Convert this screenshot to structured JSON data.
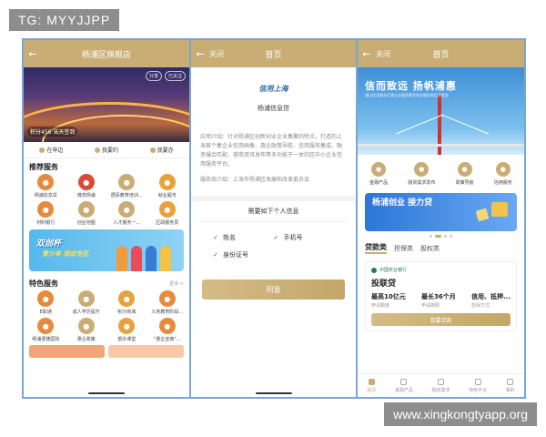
{
  "overlay": {
    "tag": "TG: MYYJJPP",
    "watermark": "www.xingkongtyapp.org"
  },
  "colors": {
    "gold": "#c9ad74",
    "frame": "#7aa6d4"
  },
  "phone1": {
    "title": "杨浦区旗舰店",
    "points": "积分456 当天签到",
    "chips": [
      "分享",
      "已关注"
    ],
    "tabs": [
      "在申边",
      "我要约",
      "我要办"
    ],
    "services_title": "推荐服务",
    "services": [
      {
        "label": "杨浦信息贷",
        "icon": "coin-icon",
        "color": "#e88a3c"
      },
      {
        "label": "博览杨浦",
        "icon": "gift-icon",
        "color": "#d94a3a"
      },
      {
        "label": "居民教育培训...",
        "icon": "book-icon",
        "color": "#c9ad74"
      },
      {
        "label": "就业超市",
        "icon": "briefcase-icon",
        "color": "#e8a23c"
      },
      {
        "label": "材料银行",
        "icon": "box-icon",
        "color": "#e88a3c"
      },
      {
        "label": "创业地图",
        "icon": "map-icon",
        "color": "#c9ad74"
      },
      {
        "label": "人才服务一...",
        "icon": "person-icon",
        "color": "#c9ad74"
      },
      {
        "label": "区政服务员",
        "icon": "badge-icon",
        "color": "#e8a23c"
      }
    ],
    "promo": {
      "title": "双创杯",
      "subtitle": "青少年 活动专区"
    },
    "featured_title": "特色服务",
    "featured_more": "更多 >",
    "featured": [
      {
        "label": "E职通",
        "icon": "bulb-icon",
        "color": "#e88a3c"
      },
      {
        "label": "成人学历提升",
        "icon": "cap-icon",
        "color": "#c9ad74"
      },
      {
        "label": "积分商城",
        "icon": "cart-icon",
        "color": "#e8a23c"
      },
      {
        "label": "义务教育阶段...",
        "icon": "school-icon",
        "color": "#e88a3c"
      },
      {
        "label": "杨浦便捷医院",
        "icon": "hospital-icon",
        "color": "#e88a3c"
      },
      {
        "label": "惠企政策",
        "icon": "doc-icon",
        "color": "#c9ad74"
      },
      {
        "label": "部办课堂",
        "icon": "class-icon",
        "color": "#e8a23c"
      },
      {
        "label": "\"惠企宣南\"...",
        "icon": "speaker-icon",
        "color": "#e88a3c"
      }
    ]
  },
  "phone2": {
    "close": "关闭",
    "title": "首页",
    "logo": "信用上海",
    "name": "杨浦信息贷",
    "desc": "应用介绍：针对杨浦区创新创业企业集聚的特点，打造的上海首个集企业信用画像、惠企政策导航、信用服务集成、融资撮合匹配、营商资讯发布等多功能于一体的区中小企业信用服务平台。",
    "org": "服务商介绍：上海市杨浦区发展和改革委员会",
    "need": "需要如下个人信息",
    "checks": [
      "姓名",
      "手机号",
      "身份证号"
    ],
    "agree": "同意"
  },
  "phone3": {
    "close": "关闭",
    "title": "首页",
    "banner_title": "信而致远 扬帆浦惠",
    "banner_sub": "通过信用服务打通企业融资需求和金融机构信息壁垒",
    "icons": [
      {
        "label": "金融产品",
        "icon": "money-bag-icon"
      },
      {
        "label": "融资需求发布",
        "icon": "send-icon"
      },
      {
        "label": "政策导航",
        "icon": "compass-icon"
      },
      {
        "label": "信用服务",
        "icon": "heart-icon"
      }
    ],
    "promo": "杨浦创业 接力贷",
    "categories": [
      "贷款类",
      "担保类",
      "股权类"
    ],
    "card": {
      "bank": "中国农业银行",
      "product": "投联贷",
      "amount_value": "最高10亿元",
      "amount_label": "申请额度",
      "term_value": "最长36个月",
      "term_label": "申请期限",
      "guarantee_value": "信用、抵押...",
      "guarantee_label": "担保方式",
      "apply": "我要贷款"
    },
    "tabbar": [
      "首页",
      "金融产品",
      "融资需求",
      "特色平台",
      "我的"
    ]
  }
}
